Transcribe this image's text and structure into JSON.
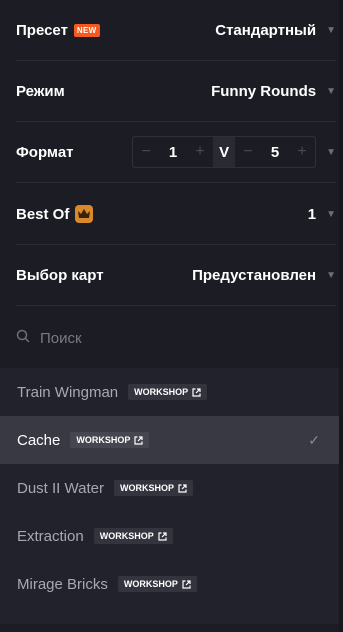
{
  "settings": {
    "preset": {
      "label": "Пресет",
      "badge": "NEW",
      "value": "Стандартный"
    },
    "mode": {
      "label": "Режим",
      "value": "Funny Rounds"
    },
    "format": {
      "label": "Формат",
      "minus": "−",
      "plus": "+",
      "left_value": "1",
      "vs": "V",
      "right_value": "5"
    },
    "best_of": {
      "label": "Best Of",
      "icon": "crown-icon",
      "value": "1"
    },
    "map_select": {
      "label": "Выбор карт",
      "value": "Предустановлен"
    }
  },
  "search": {
    "placeholder": "Поиск",
    "value": ""
  },
  "maps": {
    "workshop_label": "WORKSHOP",
    "items": [
      {
        "name": "Train Wingman",
        "selected": false
      },
      {
        "name": "Cache",
        "selected": true
      },
      {
        "name": "Dust II Water",
        "selected": false
      },
      {
        "name": "Extraction",
        "selected": false
      },
      {
        "name": "Mirage Bricks",
        "selected": false
      }
    ]
  },
  "colors": {
    "background": "#1c1c24",
    "list_background": "#22222c",
    "selected_row": "#393943",
    "new_badge": "#f25a20",
    "crown": "#d8892b"
  }
}
